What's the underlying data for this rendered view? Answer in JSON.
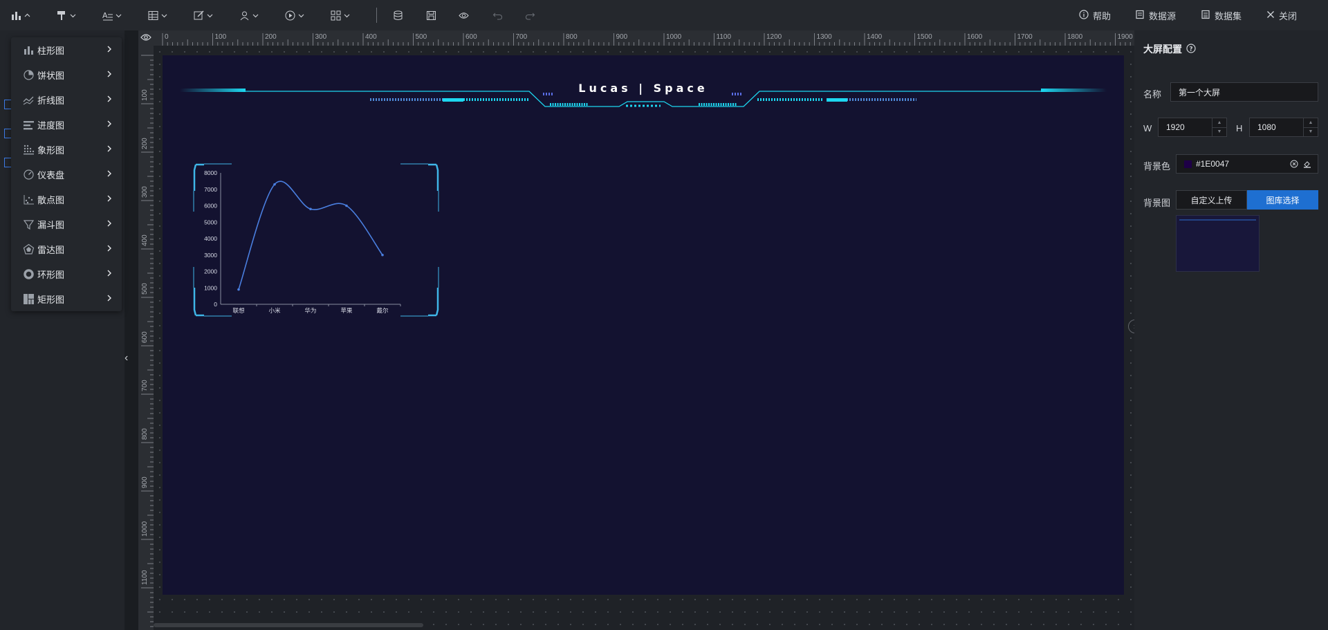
{
  "toolbar": {
    "tools": [
      {
        "icon": "bar-chart-icon",
        "caret": "chevron-up-icon"
      },
      {
        "icon": "paint-roller-icon",
        "caret": "chevron-down-icon"
      },
      {
        "icon": "text-icon",
        "caret": "chevron-down-icon"
      },
      {
        "icon": "table-icon",
        "caret": "chevron-down-icon"
      },
      {
        "icon": "edit-icon",
        "caret": "chevron-down-icon"
      },
      {
        "icon": "user-icon",
        "caret": "chevron-down-icon"
      },
      {
        "icon": "play-icon",
        "caret": "chevron-down-icon"
      },
      {
        "icon": "grid-icon",
        "caret": "chevron-down-icon"
      }
    ],
    "actions": [
      "database-icon",
      "save-icon",
      "preview-icon",
      "undo-icon",
      "redo-icon"
    ],
    "right_links": {
      "help": "帮助",
      "datasource": "数据源",
      "dataset": "数据集",
      "close": "关闭"
    }
  },
  "chart_menu": {
    "items": [
      {
        "label": "柱形图",
        "icon": "bar-chart-icon"
      },
      {
        "label": "饼状图",
        "icon": "pie-chart-icon"
      },
      {
        "label": "折线图",
        "icon": "line-chart-icon"
      },
      {
        "label": "进度图",
        "icon": "progress-chart-icon"
      },
      {
        "label": "象形图",
        "icon": "pictorial-chart-icon"
      },
      {
        "label": "仪表盘",
        "icon": "gauge-icon"
      },
      {
        "label": "散点图",
        "icon": "scatter-chart-icon"
      },
      {
        "label": "漏斗图",
        "icon": "funnel-chart-icon"
      },
      {
        "label": "雷达图",
        "icon": "radar-chart-icon"
      },
      {
        "label": "环形图",
        "icon": "ring-chart-icon"
      },
      {
        "label": "矩形图",
        "icon": "treemap-icon"
      }
    ]
  },
  "ruler": {
    "h_ticks": [
      "0",
      "100",
      "200",
      "300",
      "400",
      "500",
      "600",
      "700",
      "800",
      "900",
      "1000",
      "1100",
      "1200",
      "1300",
      "1400",
      "1500",
      "1600",
      "1700",
      "1800",
      "1900"
    ],
    "v_ticks": [
      "100",
      "200",
      "300",
      "400",
      "500",
      "600",
      "700",
      "800",
      "900",
      "1000",
      "1100"
    ]
  },
  "canvas": {
    "header_title": "Lucas | Space",
    "background": "#1E0047"
  },
  "chart_data": {
    "type": "line",
    "categories": [
      "联想",
      "小米",
      "华为",
      "苹果",
      "戴尔"
    ],
    "values": [
      900,
      7300,
      5800,
      6000,
      3000
    ],
    "ylim": [
      0,
      8000
    ],
    "yticks": [
      "0",
      "1000",
      "2000",
      "3000",
      "4000",
      "5000",
      "6000",
      "7000",
      "8000"
    ],
    "line_color": "#4a7fe0",
    "smooth": true,
    "grid": false
  },
  "config_panel": {
    "title": "大屏配置",
    "name_label": "名称",
    "name_value": "第一个大屏",
    "w_label": "W",
    "w_value": "1920",
    "h_label": "H",
    "h_value": "1080",
    "bgcolor_label": "背景色",
    "bgcolor_value": "#1E0047",
    "bgimage_label": "背景图",
    "upload_button": "自定义上传",
    "library_button": "图库选择",
    "accent": "#1e6fd1"
  }
}
